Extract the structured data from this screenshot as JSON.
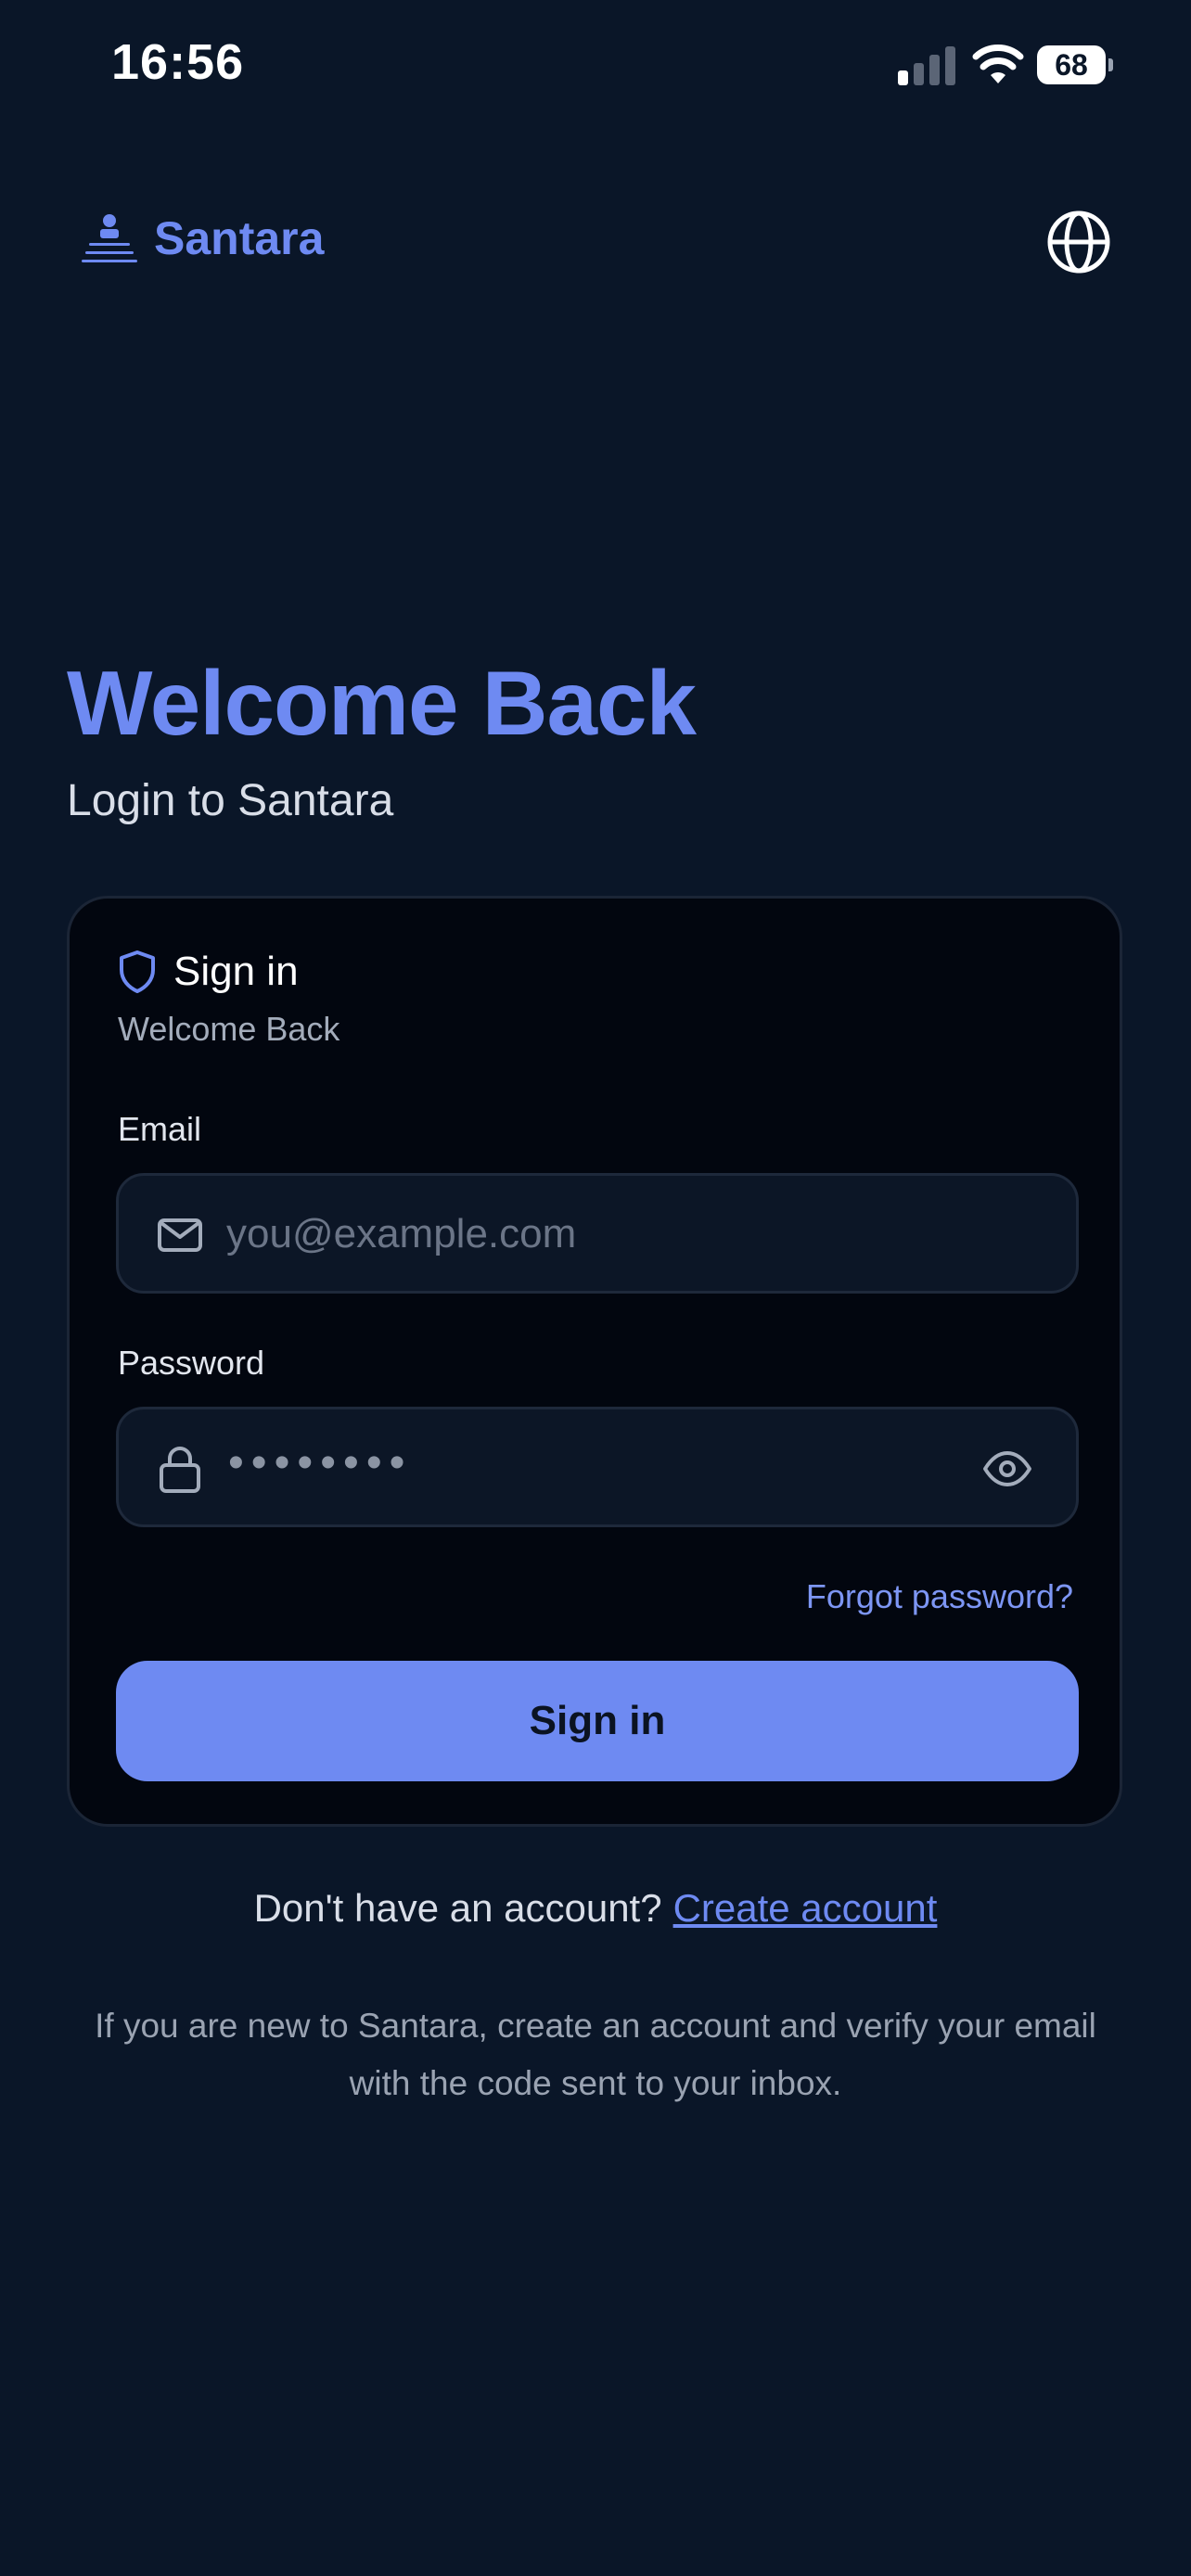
{
  "status_bar": {
    "time": "16:56",
    "battery": "68"
  },
  "header": {
    "brand_name": "Santara",
    "logo_icon": "person-podium-icon",
    "language_icon": "globe-icon"
  },
  "heading": {
    "title": "Welcome Back",
    "subtitle": "Login to Santara"
  },
  "card": {
    "icon": "shield-icon",
    "title": "Sign in",
    "subtitle": "Welcome Back",
    "email": {
      "label": "Email",
      "placeholder": "you@example.com",
      "icon": "mail-icon"
    },
    "password": {
      "label": "Password",
      "masked_value": "••••••••",
      "icon": "lock-icon",
      "toggle_icon": "eye-icon"
    },
    "forgot_link": "Forgot password?",
    "submit_label": "Sign in"
  },
  "footer": {
    "signup_prompt": "Don't have an account?",
    "signup_link": "Create account",
    "info": "If you are new to Santara, create an account and verify your email with the code sent to your inbox."
  },
  "colors": {
    "background": "#0a1628",
    "accent": "#6e8af2",
    "card": "#02060f",
    "field": "#0c1626"
  }
}
